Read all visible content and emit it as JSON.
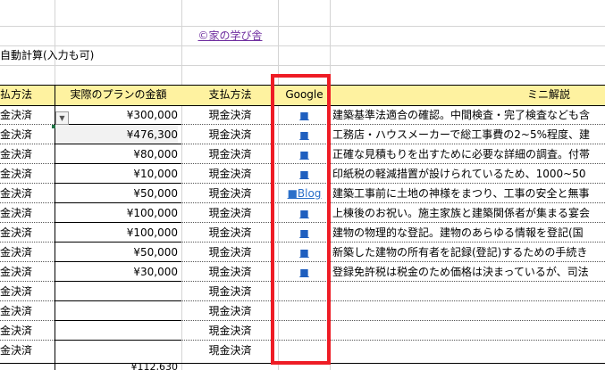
{
  "header_link": "©家の学び舎",
  "auto_calc_note": "自動計算(入力も可)",
  "columns": {
    "payment_method_partial": "払方法",
    "actual_plan_amount": "実際のプランの金額",
    "payment_method": "支払方法",
    "google": "Google",
    "mini_explanation_partial": "ミニ解説"
  },
  "dropdown_glyph": "▼",
  "rows": [
    {
      "method_a": "金決済",
      "amount": "¥300,000",
      "method_b": "現金決済",
      "google": "■",
      "note": "建築基準法適合の確認。中間検査・完了検査なども含"
    },
    {
      "method_a": "金決済",
      "amount": "¥476,300",
      "method_b": "現金決済",
      "google": "■",
      "note": "工務店・ハウスメーカーで総工事費の2~5%程度、建"
    },
    {
      "method_a": "金決済",
      "amount": "¥80,000",
      "method_b": "現金決済",
      "google": "■",
      "note": "正確な見積もりを出すために必要な詳細の調査。付帯"
    },
    {
      "method_a": "金決済",
      "amount": "¥10,000",
      "method_b": "現金決済",
      "google": "■",
      "note": "印紙税の軽減措置が設けられているため、1000~50"
    },
    {
      "method_a": "金決済",
      "amount": "¥50,000",
      "method_b": "現金決済",
      "google": "■Blog",
      "note": "建築工事前に土地の神様をまつり、工事の安全と無事"
    },
    {
      "method_a": "金決済",
      "amount": "¥100,000",
      "method_b": "現金決済",
      "google": "■",
      "note": "上棟後のお祝い。施主家族と建築関係者が集まる宴会"
    },
    {
      "method_a": "金決済",
      "amount": "¥100,000",
      "method_b": "現金決済",
      "google": "■",
      "note": "建物の物理的な登記。建物のあらゆる情報を登記(国"
    },
    {
      "method_a": "金決済",
      "amount": "¥50,000",
      "method_b": "現金決済",
      "google": "■",
      "note": "新築した建物の所有者を記録(登記)するための手続き"
    },
    {
      "method_a": "金決済",
      "amount": "¥30,000",
      "method_b": "現金決済",
      "google": "■",
      "note": "登録免許税は税金のため価格は決まっているが、司法"
    },
    {
      "method_a": "金決済",
      "amount": "",
      "method_b": "現金決済",
      "google": "",
      "note": ""
    },
    {
      "method_a": "金決済",
      "amount": "",
      "method_b": "現金決済",
      "google": "",
      "note": ""
    },
    {
      "method_a": "金決済",
      "amount": "",
      "method_b": "現金決済",
      "google": "",
      "note": ""
    },
    {
      "method_a": "金決済",
      "amount": "",
      "method_b": "現金決済",
      "google": "",
      "note": ""
    }
  ],
  "total_partial": "¥112,630",
  "highlight_color": "#ee1c25",
  "header_fill": "#fef2a0"
}
